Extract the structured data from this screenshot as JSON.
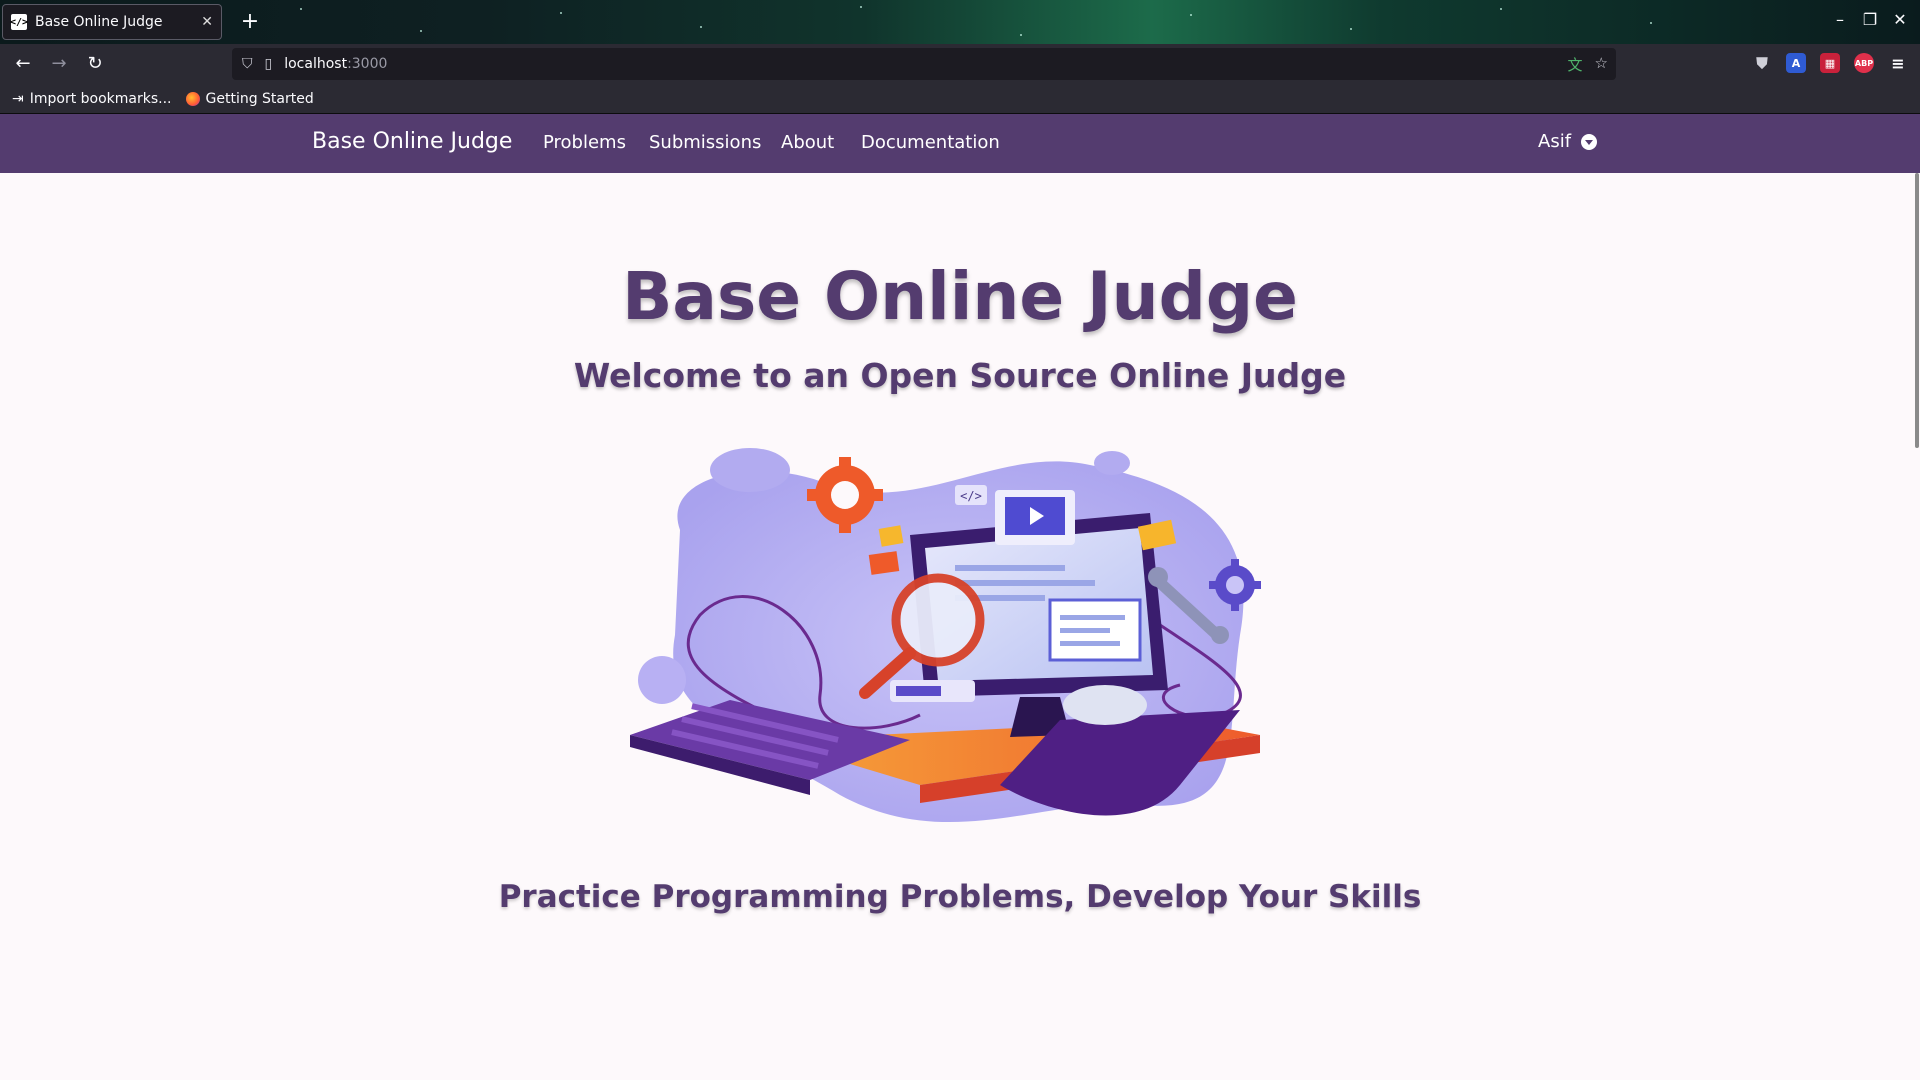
{
  "browser": {
    "tab": {
      "title": "Base Online Judge",
      "favicon": "code-icon"
    },
    "url": {
      "host": "localhost",
      "port": ":3000"
    },
    "bookmarks": [
      {
        "label": "Import bookmarks...",
        "icon": "import-icon"
      },
      {
        "label": "Getting Started",
        "icon": "firefox-icon"
      }
    ],
    "extensions": [
      {
        "name": "pocket-icon",
        "label": ""
      },
      {
        "name": "translate-ext-icon",
        "label": ""
      },
      {
        "name": "grid-ext-icon",
        "label": ""
      },
      {
        "name": "adblock-icon",
        "label": "ABP"
      }
    ]
  },
  "site": {
    "brand": "Base Online Judge",
    "nav": {
      "problems": "Problems",
      "submissions": "Submissions",
      "about": "About",
      "documentation": "Documentation"
    },
    "user": "Asif",
    "colors": {
      "nav_bg": "#543c6f",
      "text": "#543c6f",
      "page_bg": "#fdf9fb"
    }
  },
  "hero": {
    "title": "Base Online Judge",
    "subtitle": "Welcome to an Open Source Online Judge",
    "tagline": "Practice Programming Problems, Develop Your Skills"
  }
}
